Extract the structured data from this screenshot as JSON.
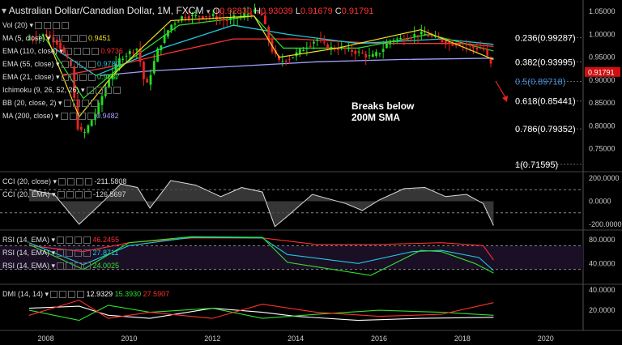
{
  "title": {
    "symbol": "Australian Dollar/Canadian Dollar, 1M, FXCM",
    "ohlc": [
      {
        "k": "O",
        "v": "0.92830"
      },
      {
        "k": "H",
        "v": "0.93039"
      },
      {
        "k": "L",
        "v": "0.91679"
      },
      {
        "k": "C",
        "v": "0.91791"
      }
    ]
  },
  "annotation": {
    "line1": "Breaks below",
    "line2": "200M SMA"
  },
  "colors": {
    "bull": "#22dd22",
    "bear": "#ee2222",
    "ma5": "#f0e020",
    "ema110": "#ff3030",
    "ema55": "#20c8e0",
    "ema21": "#30e030",
    "ma200": "#a0a0ff",
    "price_tag": "#d01010"
  },
  "indicators_main": [
    {
      "name": "Vol (20)",
      "value": "",
      "color": "#ddd"
    },
    {
      "name": "MA (5, close)",
      "value": "0.9451",
      "color": "#f0e020"
    },
    {
      "name": "EMA (110, close)",
      "value": "0.9736",
      "color": "#ff3030"
    },
    {
      "name": "EMA (55, close)",
      "value": "0.9780",
      "color": "#20c8e0"
    },
    {
      "name": "EMA (21, close)",
      "value": "0.9637",
      "color": "#30e030"
    },
    {
      "name": "Ichimoku (9, 26, 52, 26)",
      "value": "",
      "color": "#ddd"
    },
    {
      "name": "BB (20, close, 2)",
      "value": "",
      "color": "#ddd"
    },
    {
      "name": "MA (200, close)",
      "value": "0.9482",
      "color": "#a0a0ff"
    }
  ],
  "indicators_cci": [
    {
      "name": "CCI (20, close)",
      "value": "-211.5808",
      "color": "#ddd"
    },
    {
      "name": "CCI (20, EMA)",
      "value": "-126.5697",
      "color": "#ddd"
    }
  ],
  "indicators_rsi": [
    {
      "name": "RSI (14, EMA)",
      "value": "46.2455",
      "color": "#ff3030"
    },
    {
      "name": "RSI (14, EMA)",
      "value": "27.8711",
      "color": "#20c8e0"
    },
    {
      "name": "RSI (14, EMA)",
      "value": "24.0025",
      "color": "#30e030"
    }
  ],
  "indicators_dmi": {
    "name": "DMI (14, 14)",
    "values": [
      {
        "v": "12.9329",
        "color": "#ffffff"
      },
      {
        "v": "15.3930",
        "color": "#30e030"
      },
      {
        "v": "27.5907",
        "color": "#ff3030"
      }
    ]
  },
  "chart_data": {
    "type": "candlestick",
    "timeframe": "1M",
    "x_axis_labels": [
      "2008",
      "2010",
      "2012",
      "2014",
      "2016",
      "2018",
      "2020"
    ],
    "main_y_ticks": [
      "1.05000",
      "1.00000",
      "0.95000",
      "0.90000",
      "0.85000",
      "0.80000",
      "0.75000"
    ],
    "main_ylim": [
      0.7,
      1.075
    ],
    "last_price": "0.91791",
    "fibonacci": [
      {
        "label": "0.236(0.99287)",
        "value": 0.99287,
        "color": "#ffffff"
      },
      {
        "label": "0.382(0.93995)",
        "value": 0.93995,
        "color": "#ffffff"
      },
      {
        "label": "0.5(0.89718)",
        "value": 0.89718,
        "color": "#4a90e0"
      },
      {
        "label": "0.618(0.85441)",
        "value": 0.85441,
        "color": "#ffffff"
      },
      {
        "label": "0.786(0.79352)",
        "value": 0.79352,
        "color": "#ffffff"
      },
      {
        "label": "1(0.71595)",
        "value": 0.71595,
        "color": "#ffffff"
      }
    ],
    "price_path": [
      [
        2007.6,
        0.99
      ],
      [
        2008.0,
        1.0
      ],
      [
        2008.3,
        0.98
      ],
      [
        2008.6,
        0.93
      ],
      [
        2008.75,
        0.8
      ],
      [
        2008.9,
        0.78
      ],
      [
        2009.2,
        0.83
      ],
      [
        2009.5,
        0.9
      ],
      [
        2009.8,
        0.95
      ],
      [
        2010.2,
        0.97
      ],
      [
        2010.4,
        0.88
      ],
      [
        2010.7,
        0.97
      ],
      [
        2011.0,
        1.02
      ],
      [
        2011.3,
        1.04
      ],
      [
        2011.7,
        1.04
      ],
      [
        2012.0,
        1.04
      ],
      [
        2012.3,
        1.03
      ],
      [
        2012.7,
        1.04
      ],
      [
        2013.0,
        1.05
      ],
      [
        2013.2,
        1.04
      ],
      [
        2013.4,
        0.97
      ],
      [
        2013.6,
        0.94
      ],
      [
        2013.9,
        0.95
      ],
      [
        2014.2,
        0.97
      ],
      [
        2014.5,
        0.99
      ],
      [
        2014.8,
        0.97
      ],
      [
        2015.1,
        0.97
      ],
      [
        2015.5,
        0.96
      ],
      [
        2015.8,
        0.95
      ],
      [
        2016.0,
        0.96
      ],
      [
        2016.3,
        0.99
      ],
      [
        2016.6,
        0.99
      ],
      [
        2016.9,
        1.0
      ],
      [
        2017.1,
        1.0
      ],
      [
        2017.4,
        0.99
      ],
      [
        2017.7,
        0.98
      ],
      [
        2018.0,
        0.98
      ],
      [
        2018.3,
        0.97
      ],
      [
        2018.5,
        0.97
      ],
      [
        2018.7,
        0.93
      ],
      [
        2018.75,
        0.918
      ]
    ],
    "ma200_path": [
      [
        2009.3,
        0.91
      ],
      [
        2010.5,
        0.92
      ],
      [
        2012.5,
        0.93
      ],
      [
        2014.5,
        0.94
      ],
      [
        2016.5,
        0.945
      ],
      [
        2018.75,
        0.948
      ]
    ],
    "ema110_path": [
      [
        2008.4,
        0.91
      ],
      [
        2009.6,
        0.93
      ],
      [
        2011.0,
        0.96
      ],
      [
        2012.5,
        0.99
      ],
      [
        2014.0,
        0.99
      ],
      [
        2016.0,
        0.98
      ],
      [
        2018.0,
        0.98
      ],
      [
        2018.75,
        0.9736
      ]
    ],
    "ema55_path": [
      [
        2008.2,
        0.97
      ],
      [
        2009.2,
        0.91
      ],
      [
        2010.8,
        0.97
      ],
      [
        2012.5,
        1.02
      ],
      [
        2013.8,
        1.0
      ],
      [
        2015.5,
        0.98
      ],
      [
        2017.5,
        0.99
      ],
      [
        2018.75,
        0.978
      ]
    ],
    "ema21_path": [
      [
        2008.0,
        0.99
      ],
      [
        2008.9,
        0.86
      ],
      [
        2009.8,
        0.93
      ],
      [
        2011.2,
        1.02
      ],
      [
        2013.0,
        1.04
      ],
      [
        2013.7,
        0.97
      ],
      [
        2015.5,
        0.97
      ],
      [
        2017.2,
        1.0
      ],
      [
        2018.75,
        0.9637
      ]
    ],
    "ma5_path": [
      [
        2008.0,
        1.0
      ],
      [
        2008.8,
        0.82
      ],
      [
        2009.6,
        0.91
      ],
      [
        2011.0,
        1.03
      ],
      [
        2013.0,
        1.04
      ],
      [
        2013.6,
        0.95
      ],
      [
        2015.0,
        0.97
      ],
      [
        2017.0,
        1.01
      ],
      [
        2018.75,
        0.9451
      ]
    ],
    "cci_ticks": [
      "200.0000",
      "0.0000",
      "-200.0000"
    ],
    "cci_ylim": [
      -250,
      250
    ],
    "cci_path": [
      [
        2007.6,
        100
      ],
      [
        2008.2,
        60
      ],
      [
        2008.8,
        -200
      ],
      [
        2009.3,
        -30
      ],
      [
        2009.8,
        150
      ],
      [
        2010.2,
        120
      ],
      [
        2010.5,
        -60
      ],
      [
        2011.0,
        180
      ],
      [
        2011.6,
        140
      ],
      [
        2012.2,
        40
      ],
      [
        2012.7,
        120
      ],
      [
        2013.2,
        80
      ],
      [
        2013.5,
        -220
      ],
      [
        2013.8,
        -130
      ],
      [
        2014.4,
        60
      ],
      [
        2015.2,
        -20
      ],
      [
        2015.6,
        -80
      ],
      [
        2016.0,
        10
      ],
      [
        2016.6,
        110
      ],
      [
        2017.1,
        120
      ],
      [
        2017.6,
        40
      ],
      [
        2018.1,
        60
      ],
      [
        2018.5,
        -20
      ],
      [
        2018.75,
        -211
      ]
    ],
    "rsi_ticks": [
      "80.0000",
      "40.0000"
    ],
    "rsi_ylim": [
      5,
      95
    ],
    "rsi_series": [
      {
        "color": "#ff3030",
        "points": [
          [
            2007.6,
            70
          ],
          [
            2008.9,
            60
          ],
          [
            2010.0,
            75
          ],
          [
            2011.5,
            83
          ],
          [
            2013.2,
            83
          ],
          [
            2014.5,
            72
          ],
          [
            2016.0,
            72
          ],
          [
            2017.5,
            75
          ],
          [
            2018.5,
            70
          ],
          [
            2018.75,
            46
          ]
        ]
      },
      {
        "color": "#20c8e0",
        "points": [
          [
            2007.6,
            75
          ],
          [
            2008.9,
            38
          ],
          [
            2010.0,
            70
          ],
          [
            2011.5,
            84
          ],
          [
            2013.2,
            83
          ],
          [
            2013.8,
            55
          ],
          [
            2015.5,
            40
          ],
          [
            2016.8,
            60
          ],
          [
            2017.5,
            62
          ],
          [
            2018.4,
            50
          ],
          [
            2018.75,
            28
          ]
        ]
      },
      {
        "color": "#30e030",
        "points": [
          [
            2007.6,
            72
          ],
          [
            2008.9,
            30
          ],
          [
            2010.0,
            75
          ],
          [
            2011.5,
            85
          ],
          [
            2013.2,
            84
          ],
          [
            2013.8,
            42
          ],
          [
            2015.8,
            20
          ],
          [
            2017.0,
            62
          ],
          [
            2017.5,
            60
          ],
          [
            2018.3,
            40
          ],
          [
            2018.75,
            24
          ]
        ]
      }
    ],
    "dmi_ticks": [
      "40.0000",
      "20.0000"
    ],
    "dmi_ylim": [
      0,
      45
    ],
    "dmi_series": [
      {
        "color": "#ffffff",
        "points": [
          [
            2007.6,
            22
          ],
          [
            2008.8,
            24
          ],
          [
            2009.5,
            15
          ],
          [
            2010.5,
            12
          ],
          [
            2012.0,
            22
          ],
          [
            2013.2,
            18
          ],
          [
            2014.0,
            14
          ],
          [
            2015.5,
            10
          ],
          [
            2017.0,
            12
          ],
          [
            2018.75,
            13
          ]
        ]
      },
      {
        "color": "#30e030",
        "points": [
          [
            2007.6,
            20
          ],
          [
            2008.8,
            10
          ],
          [
            2009.5,
            25
          ],
          [
            2010.5,
            18
          ],
          [
            2012.0,
            22
          ],
          [
            2013.2,
            12
          ],
          [
            2014.5,
            16
          ],
          [
            2016.0,
            20
          ],
          [
            2017.5,
            18
          ],
          [
            2018.75,
            15
          ]
        ]
      },
      {
        "color": "#ff3030",
        "points": [
          [
            2007.6,
            15
          ],
          [
            2008.8,
            30
          ],
          [
            2009.5,
            12
          ],
          [
            2010.5,
            18
          ],
          [
            2012.0,
            12
          ],
          [
            2013.2,
            26
          ],
          [
            2014.5,
            18
          ],
          [
            2016.0,
            14
          ],
          [
            2017.5,
            16
          ],
          [
            2018.75,
            27.6
          ]
        ]
      }
    ]
  }
}
